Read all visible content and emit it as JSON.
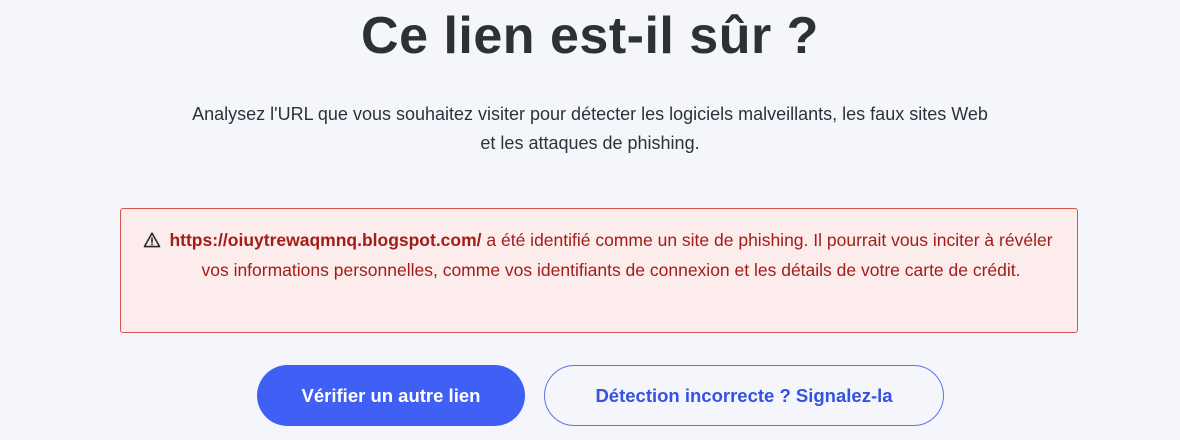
{
  "page": {
    "title": "Ce lien est-il sûr ?",
    "subtitle_line1": "Analysez l'URL que vous souhaitez visiter pour détecter les logiciels malveillants, les faux sites Web",
    "subtitle_line2": "et les attaques de phishing."
  },
  "alert": {
    "icon": "warning-triangle-icon",
    "url": "https://oiuytrewaqmnq.blogspot.com/",
    "message": " a été identifié comme un site de phishing. Il pourrait vous inciter à révéler vos informations personnelles, comme vos identifiants de connexion et les détails de votre carte de crédit.",
    "color": "#a11d17",
    "background": "#fdecec",
    "border_color": "#d9534f"
  },
  "actions": {
    "check_another_label": "Vérifier un autre lien",
    "report_label": "Détection incorrecte ? Signalez-la",
    "primary_color": "#3f5ff5"
  }
}
